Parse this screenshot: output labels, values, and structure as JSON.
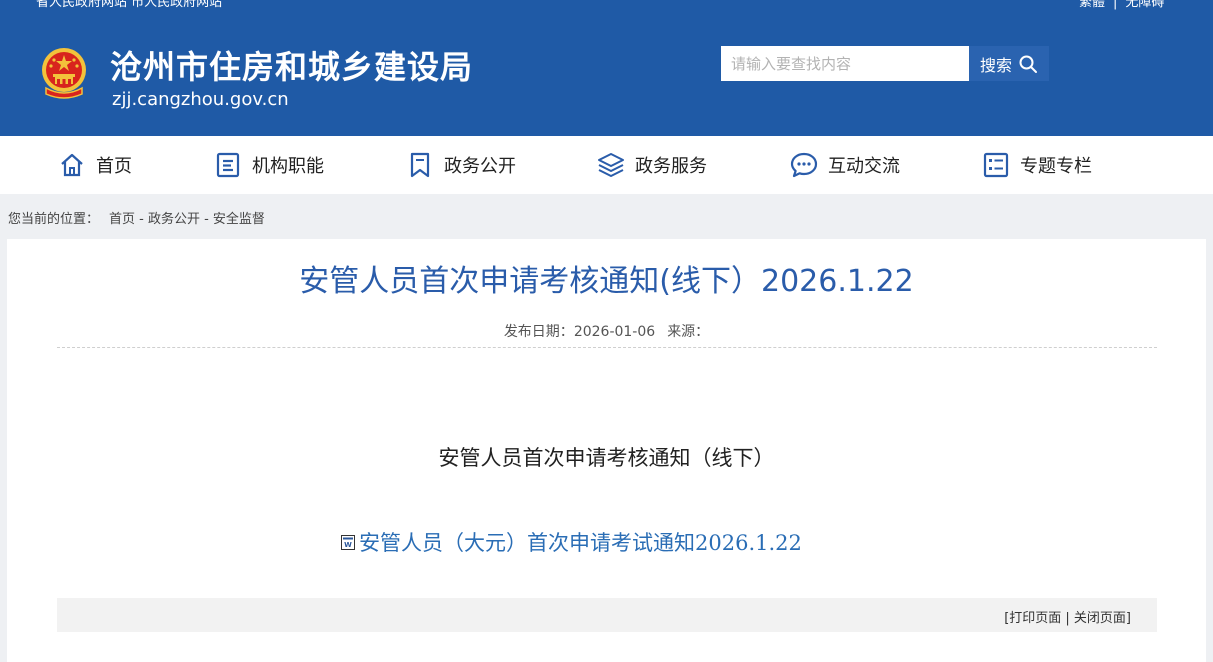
{
  "header": {
    "top_left_text": "省人民政府网站  市人民政府网站",
    "top_right_links": [
      "繁體",
      "无障碍"
    ],
    "site_title": "沧州市住房和城乡建设局",
    "site_domain": "zjj.cangzhou.gov.cn",
    "search_placeholder": "请输入要查找内容",
    "search_button_label": "搜索",
    "brand_color": "#1f5aa6"
  },
  "nav": {
    "items": [
      {
        "label": "首页",
        "icon": "home-icon"
      },
      {
        "label": "机构职能",
        "icon": "document-icon"
      },
      {
        "label": "政务公开",
        "icon": "bookmark-icon"
      },
      {
        "label": "政务服务",
        "icon": "layers-icon"
      },
      {
        "label": "互动交流",
        "icon": "chat-icon"
      },
      {
        "label": "专题专栏",
        "icon": "list-icon"
      }
    ]
  },
  "breadcrumb": {
    "prefix": "您当前的位置：",
    "path": "首页 - 政务公开 - 安全监督"
  },
  "article": {
    "title": "安管人员首次申请考核通知(线下）2026.1.22",
    "publish_label": "发布日期：",
    "publish_date": "2026-01-06",
    "source_label": "来源：",
    "source_value": "",
    "body_heading": "安管人员首次申请考核通知（线下）",
    "attachment_text": "安管人员（大元）首次申请考试通知2026.1.22",
    "title_color": "#2a5caa",
    "link_color": "#2a6db5"
  },
  "footer": {
    "print_label": "[打印页面",
    "separator": " | ",
    "close_label": "关闭页面]"
  }
}
